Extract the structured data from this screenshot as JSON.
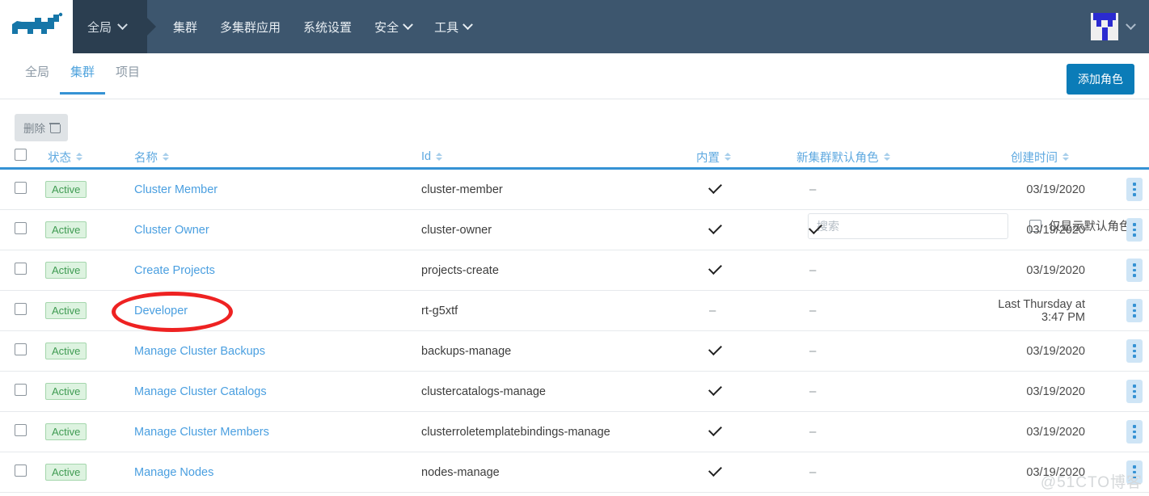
{
  "header": {
    "logo_alt": "rancher-logo",
    "global_menu": "全局",
    "nav_items": [
      {
        "label": "集群",
        "caret": false
      },
      {
        "label": "多集群应用",
        "caret": false
      },
      {
        "label": "系统设置",
        "caret": false
      },
      {
        "label": "安全",
        "caret": true
      },
      {
        "label": "工具",
        "caret": true
      }
    ],
    "avatar_alt": "user-avatar"
  },
  "tabs": [
    {
      "label": "全局",
      "active": false
    },
    {
      "label": "集群",
      "active": true
    },
    {
      "label": "项目",
      "active": false
    }
  ],
  "actions": {
    "add_role": "添加角色",
    "delete": "删除"
  },
  "search": {
    "placeholder": "搜索",
    "value": ""
  },
  "filter": {
    "default_only_label": "仅显示默认角色",
    "checked": false
  },
  "table": {
    "columns": [
      {
        "key": "state",
        "label": "状态"
      },
      {
        "key": "name",
        "label": "名称"
      },
      {
        "key": "id",
        "label": "Id"
      },
      {
        "key": "builtin",
        "label": "内置"
      },
      {
        "key": "default",
        "label": "新集群默认角色"
      },
      {
        "key": "created",
        "label": "创建时间"
      }
    ],
    "rows": [
      {
        "state": "Active",
        "name": "Cluster Member",
        "id": "cluster-member",
        "builtin": "check",
        "default": "dash",
        "created": "03/19/2020"
      },
      {
        "state": "Active",
        "name": "Cluster Owner",
        "id": "cluster-owner",
        "builtin": "check",
        "default": "check",
        "created": "03/19/2020"
      },
      {
        "state": "Active",
        "name": "Create Projects",
        "id": "projects-create",
        "builtin": "check",
        "default": "dash",
        "created": "03/19/2020"
      },
      {
        "state": "Active",
        "name": "Developer",
        "id": "rt-g5xtf",
        "builtin": "dash",
        "default": "dash",
        "created": "Last Thursday at 3:47 PM"
      },
      {
        "state": "Active",
        "name": "Manage Cluster Backups",
        "id": "backups-manage",
        "builtin": "check",
        "default": "dash",
        "created": "03/19/2020"
      },
      {
        "state": "Active",
        "name": "Manage Cluster Catalogs",
        "id": "clustercatalogs-manage",
        "builtin": "check",
        "default": "dash",
        "created": "03/19/2020"
      },
      {
        "state": "Active",
        "name": "Manage Cluster Members",
        "id": "clusterroletemplatebindings-manage",
        "builtin": "check",
        "default": "dash",
        "created": "03/19/2020"
      },
      {
        "state": "Active",
        "name": "Manage Nodes",
        "id": "nodes-manage",
        "builtin": "check",
        "default": "dash",
        "created": "03/19/2020"
      }
    ]
  },
  "annotation": {
    "target": "Developer",
    "color": "#ee2222"
  },
  "watermark": "@51CTO博客",
  "colors": {
    "nav_bg": "#3d566e",
    "nav_active_bg": "#2b3e50",
    "accent": "#3592d4",
    "primary_button": "#0b7cb8",
    "badge_green": "#3f9b52",
    "link": "#4a9fe0"
  }
}
